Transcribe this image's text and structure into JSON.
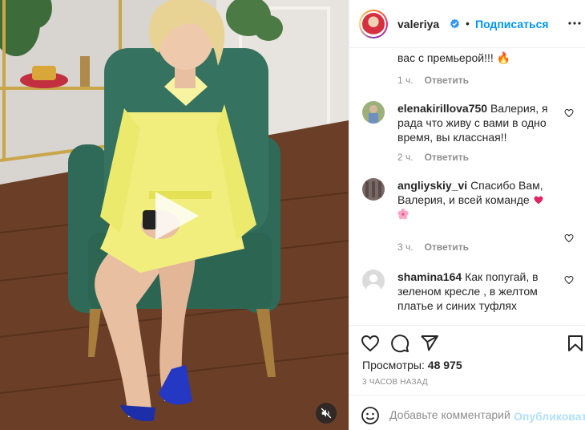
{
  "post": {
    "username": "valeriya",
    "follow_label": "Подписаться",
    "separator": "•"
  },
  "comments": [
    {
      "text_tail": "вас с премьерой!!! 🔥",
      "time": "1 ч.",
      "reply": "Ответить"
    },
    {
      "username": "elenakirillova750",
      "text": "Валерия, я рада что живу с вами в одно время, вы классная!!",
      "time": "2 ч.",
      "reply": "Ответить"
    },
    {
      "username": "angliyskiy_vi",
      "text": "Спасибо Вам, Валерия, и всей команде",
      "time": "3 ч.",
      "reply": "Ответить"
    },
    {
      "username": "shamina164",
      "text": "Как попугай, в зеленом кресле , в желтом платье и синих туфлях"
    }
  ],
  "stats": {
    "views_label": "Просмотры:",
    "views_value": "48 975",
    "posted_ago": "3 часов назад"
  },
  "add_comment": {
    "placeholder": "Добавьте комментарий...",
    "publish_label": "Опубликовать"
  },
  "icons": {
    "verified": "verified-badge-icon",
    "more": "more-options-icon",
    "like": "heart-icon",
    "comment": "comment-icon",
    "share": "paper-plane-icon",
    "save": "bookmark-icon",
    "emoji": "smiley-icon",
    "play": "play-icon",
    "mute": "speaker-muted-icon"
  },
  "colors": {
    "follow_blue": "#0095f6",
    "verified_blue": "#3897f0",
    "publish_disabled": "#b2dffc",
    "muted_text": "#8e8e8e"
  }
}
